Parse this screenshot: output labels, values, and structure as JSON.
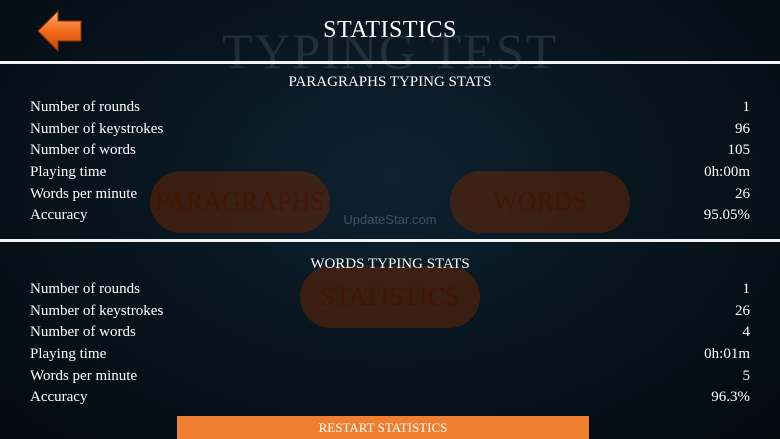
{
  "background": {
    "title": "TYPING TEST",
    "buttons": {
      "paragraphs": "PARAGRAPHS",
      "words": "WORDS",
      "statistics": "STATISTICS"
    },
    "watermark": "UpdateStar.com"
  },
  "header": {
    "title": "STATISTICS",
    "back_icon": "back-arrow-icon"
  },
  "paragraphs_stats": {
    "title": "PARAGRAPHS TYPING STATS",
    "rows": [
      {
        "label": "Number of rounds",
        "value": "1"
      },
      {
        "label": "Number of keystrokes",
        "value": "96"
      },
      {
        "label": "Number of words",
        "value": "105"
      },
      {
        "label": "Playing time",
        "value": "0h:00m"
      },
      {
        "label": "Words per minute",
        "value": "26"
      },
      {
        "label": "Accuracy",
        "value": "95.05%"
      }
    ]
  },
  "words_stats": {
    "title": "WORDS TYPING STATS",
    "rows": [
      {
        "label": "Number of rounds",
        "value": "1"
      },
      {
        "label": "Number of keystrokes",
        "value": "26"
      },
      {
        "label": "Number of words",
        "value": "4"
      },
      {
        "label": "Playing time",
        "value": "0h:01m"
      },
      {
        "label": "Words per minute",
        "value": "5"
      },
      {
        "label": "Accuracy",
        "value": "96.3%"
      }
    ]
  },
  "footer": {
    "restart_label": "RESTART STATISTICS"
  },
  "colors": {
    "accent_orange": "#f08030",
    "divider": "#f2f2f2",
    "background": "#07131c"
  }
}
